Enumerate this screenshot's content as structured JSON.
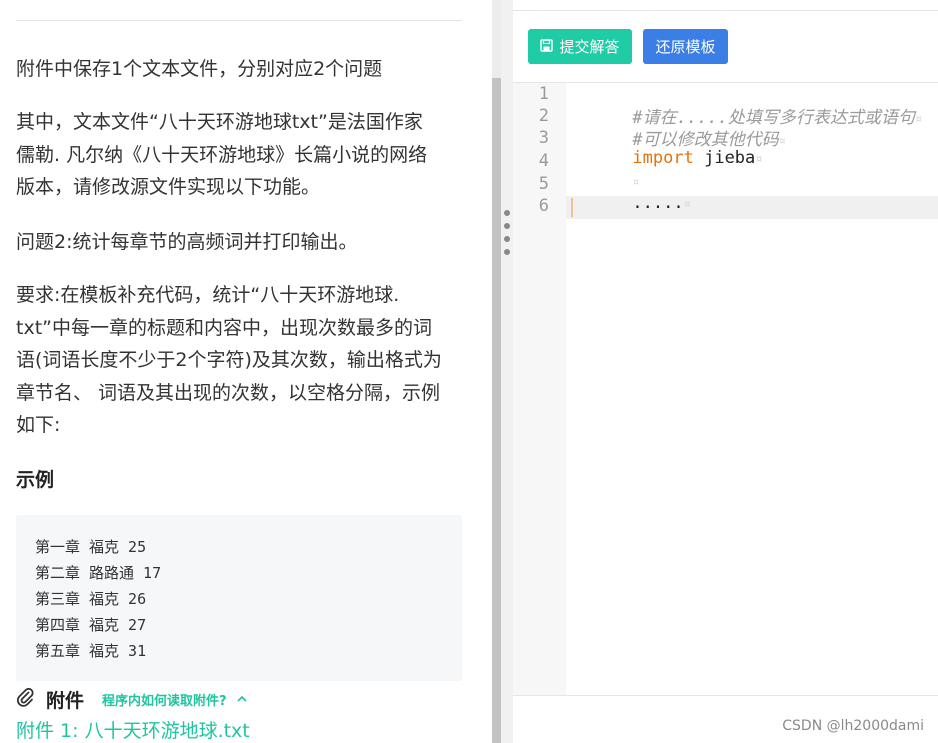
{
  "problem": {
    "p1": "附件中保存1个文本文件，分别对应2个问题",
    "p2_lines": [
      "其中，文本文件“八十天环游地球txt”是法国作家",
      "儒勒. 凡尔纳《八十天环游地球》长篇小说的网络",
      "版本，请修改源文件实现以下功能。"
    ],
    "p3": "问题2:统计每章节的高频词并打印输出。",
    "p4_lines": [
      "要求:在模板补充代码，统计“八十天环游地球.",
      "txt”中每一章的标题和内容中，出现次数最多的词",
      "语(词语长度不少于2个字符)及其次数，输出格式为",
      "章节名、 词语及其出现的次数，以空格分隔，示例",
      "如下:"
    ],
    "example_heading": "示例",
    "example_lines": [
      "第一章 福克 25",
      "第二章 路路通 17",
      "第三章 福克 26",
      "第四章 福克 27",
      "第五章 福克 31"
    ]
  },
  "attachments": {
    "title": "附件",
    "help_link": "程序内如何读取附件?",
    "file_link": "附件 1: 八十天环游地球.txt",
    "icons": {
      "clip": "paperclip-icon",
      "toggle": "chevron-up-icon"
    }
  },
  "toolbar": {
    "submit_label": "提交解答",
    "reset_label": "还原模板",
    "submit_icon": "save-icon"
  },
  "editor": {
    "line_numbers": [
      "1",
      "2",
      "3",
      "4",
      "5",
      "6"
    ],
    "comment1": "#请在.....处填写多行表达式或语句",
    "comment2": "#可以修改其他代码",
    "import_kw": "import",
    "module": "jieba",
    "dots": ".....",
    "invisible_mark": "¤",
    "current_line": 6
  },
  "watermark": "CSDN @lh2000dami",
  "colors": {
    "accent_green": "#1fcca6",
    "accent_blue": "#3a7ee6",
    "keyword_orange": "#e6720a"
  }
}
